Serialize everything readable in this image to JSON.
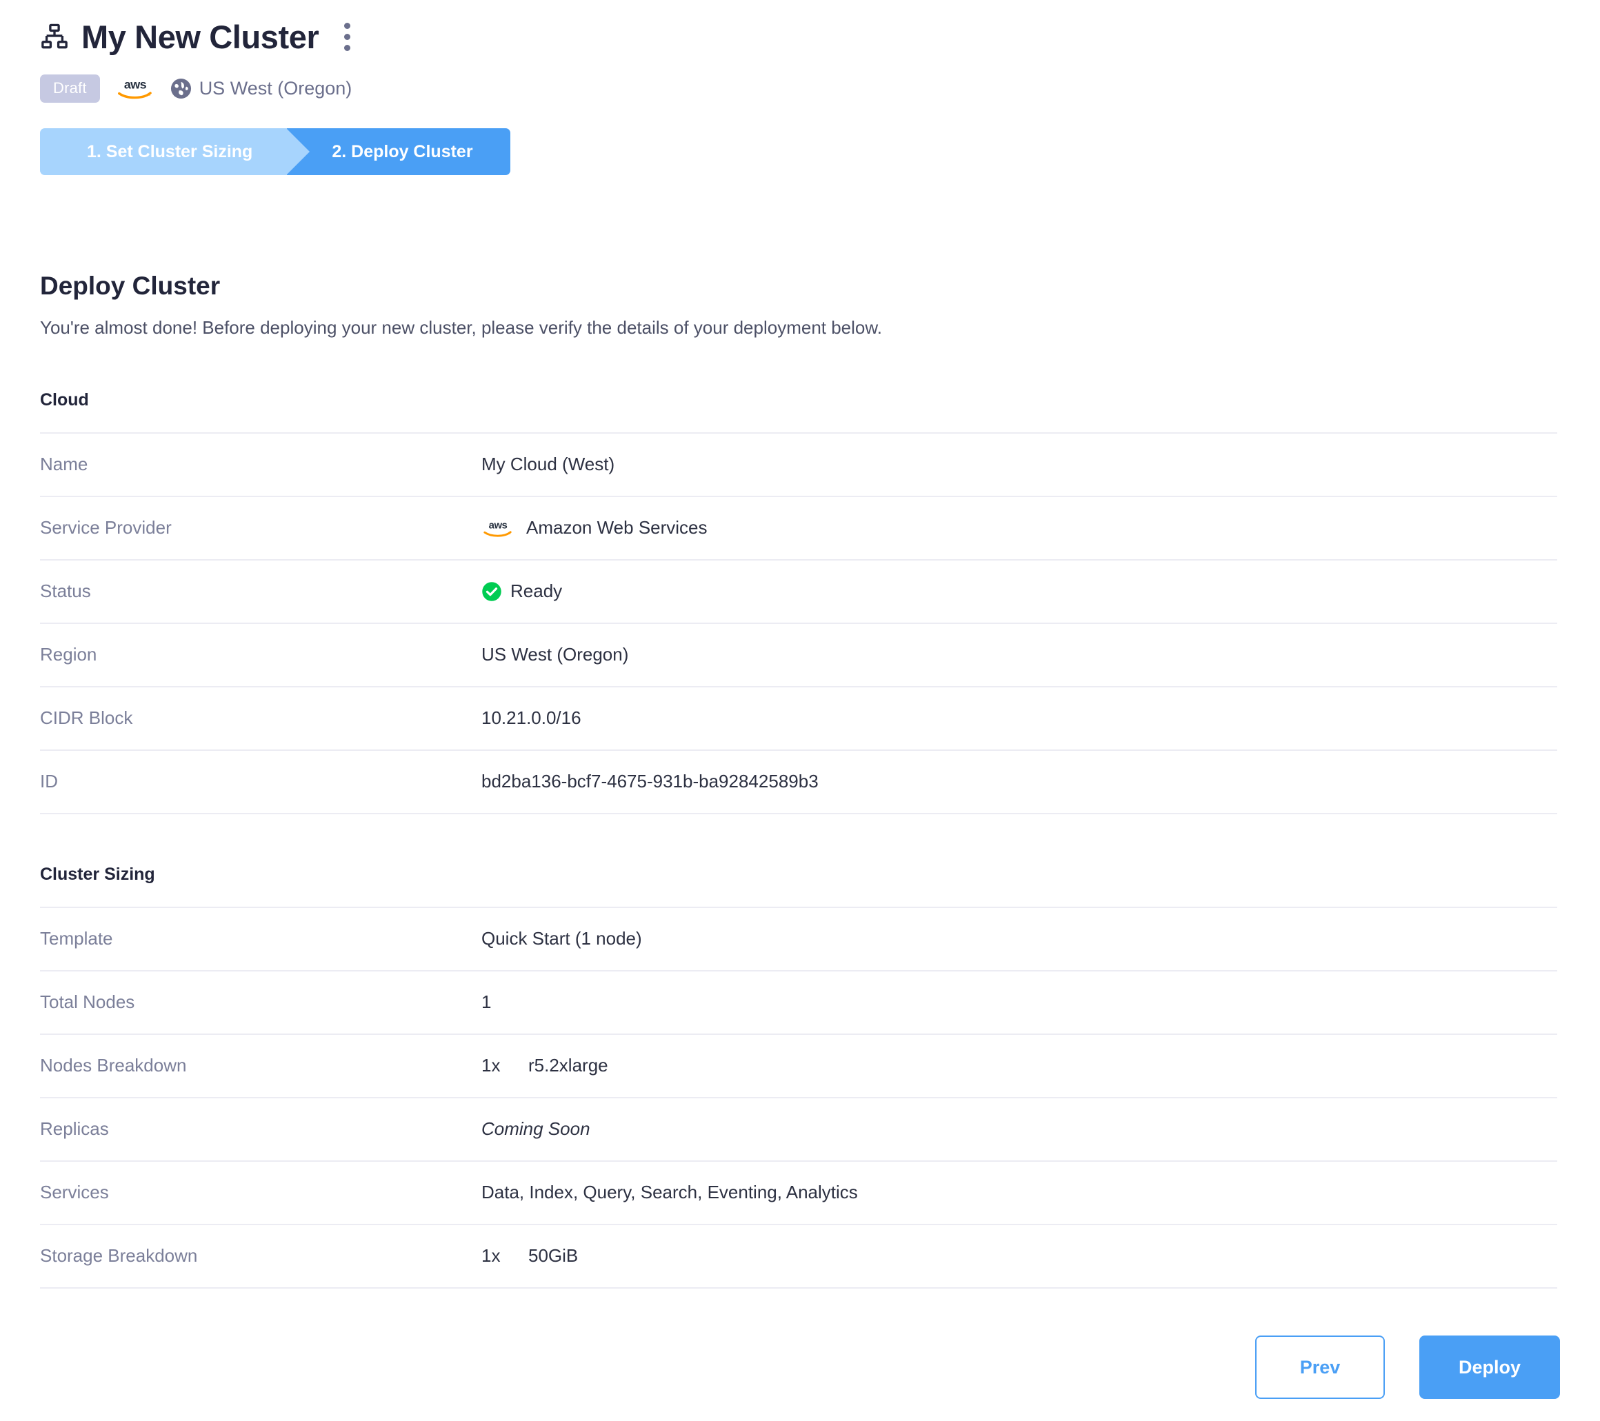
{
  "header": {
    "cluster_icon": "sitemap-icon",
    "title": "My New Cluster",
    "kebab_icon": "kebab-menu-icon",
    "badge": "Draft",
    "provider_icon": "aws-logo-icon",
    "region_icon": "globe-icon",
    "region": "US West (Oregon)"
  },
  "steps": [
    {
      "label": "1. Set Cluster Sizing",
      "state": "complete",
      "color": "#a7d4fd"
    },
    {
      "label": "2. Deploy Cluster",
      "state": "active",
      "color": "#4a9ff5"
    }
  ],
  "main": {
    "title": "Deploy Cluster",
    "subtitle": "You're almost done! Before deploying your new cluster, please verify the details of your deployment below."
  },
  "cloud": {
    "heading": "Cloud",
    "rows": [
      {
        "label": "Name",
        "value": "My Cloud (West)"
      },
      {
        "label": "Service Provider",
        "value": "Amazon Web Services",
        "icon": "aws-logo-icon"
      },
      {
        "label": "Status",
        "value": "Ready",
        "icon": "status-ready-check-icon",
        "icon_color": "#00cc52"
      },
      {
        "label": "Region",
        "value": "US West (Oregon)"
      },
      {
        "label": "CIDR Block",
        "value": "10.21.0.0/16"
      },
      {
        "label": "ID",
        "value": "bd2ba136-bcf7-4675-931b-ba92842589b3"
      }
    ]
  },
  "cluster_sizing": {
    "heading": "Cluster Sizing",
    "rows": [
      {
        "label": "Template",
        "value": "Quick Start (1 node)"
      },
      {
        "label": "Total Nodes",
        "value": "1"
      },
      {
        "label": "Nodes Breakdown",
        "qty": "1x",
        "value": "r5.2xlarge"
      },
      {
        "label": "Replicas",
        "value": "Coming Soon",
        "style": "italic"
      },
      {
        "label": "Services",
        "value": "Data, Index, Query, Search, Eventing, Analytics"
      },
      {
        "label": "Storage Breakdown",
        "qty": "1x",
        "value": "50GiB"
      }
    ]
  },
  "footer": {
    "prev_label": "Prev",
    "deploy_label": "Deploy",
    "accent_color": "#4a9ff5"
  }
}
